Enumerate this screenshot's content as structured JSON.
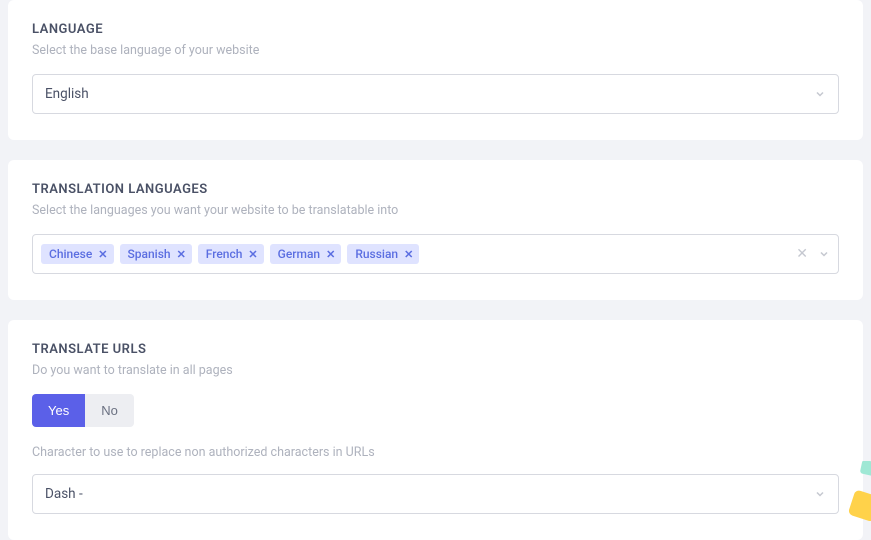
{
  "language": {
    "title": "LANGUAGE",
    "subtitle": "Select the base language of your website",
    "value": "English"
  },
  "translation": {
    "title": "TRANSLATION LANGUAGES",
    "subtitle": "Select the languages you want your website to be translatable into",
    "tags": [
      "Chinese",
      "Spanish",
      "French",
      "German",
      "Russian"
    ]
  },
  "urls": {
    "title": "TRANSLATE URLS",
    "subtitle": "Do you want to translate in all pages",
    "yes": "Yes",
    "no": "No",
    "char_label": "Character to use to replace non authorized characters in URLs",
    "char_value": "Dash -"
  }
}
